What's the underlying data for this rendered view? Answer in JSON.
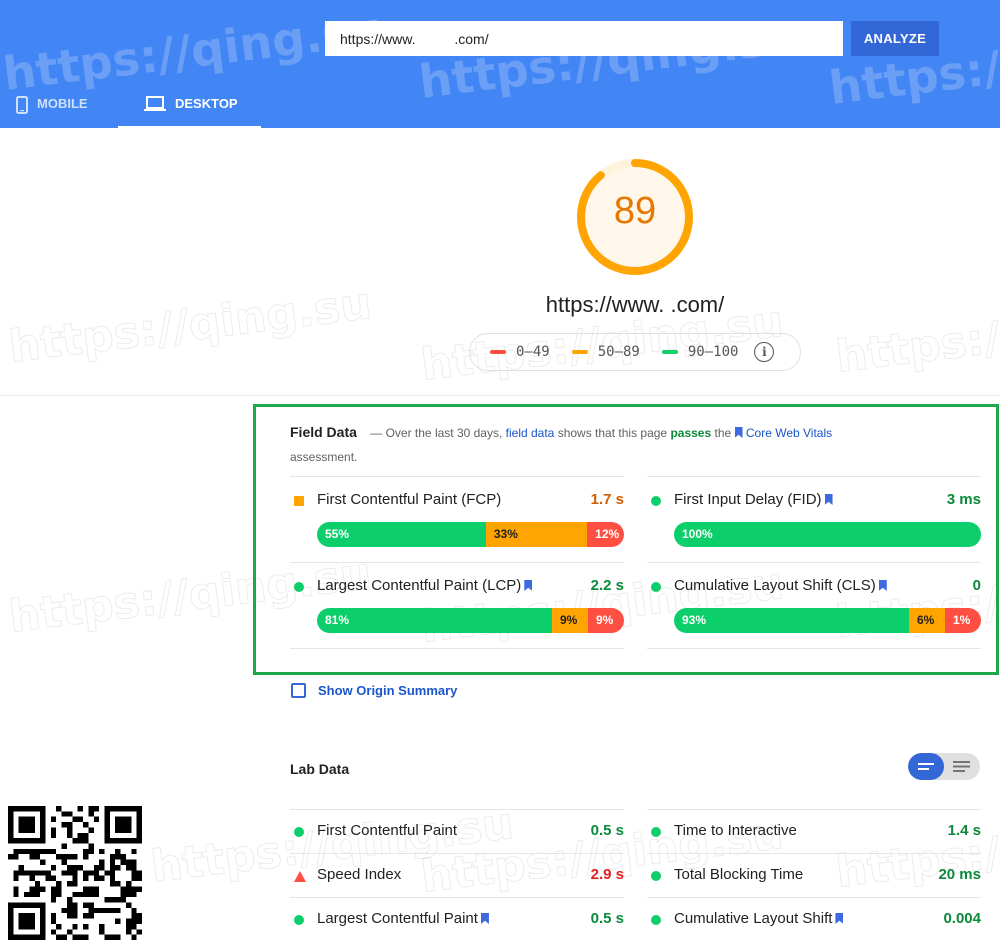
{
  "header": {
    "url_value": "https://www.          .com/",
    "analyze_label": "ANALYZE",
    "tabs": [
      {
        "label": "MOBILE",
        "icon": "mobile-phone-icon",
        "active": false
      },
      {
        "label": "DESKTOP",
        "icon": "laptop-icon",
        "active": true
      }
    ]
  },
  "watermark": "https://qing.su",
  "score": {
    "value": "89",
    "fraction": 0.89,
    "color": "#ffa400",
    "url": "https://www.          .com/"
  },
  "legend": [
    {
      "label": "0–49",
      "color": "#ff4e42"
    },
    {
      "label": "50–89",
      "color": "#ffa400"
    },
    {
      "label": "90–100",
      "color": "#0cce6b"
    }
  ],
  "legend_info_icon": "info-icon",
  "field_data": {
    "title": "Field Data",
    "desc_prefix": "— Over the last 30 days,",
    "link": "field data",
    "desc_mid": "shows that this page",
    "pass_word": "passes",
    "desc_the": "the",
    "cwv_link": "Core Web Vitals",
    "desc_suffix": "assessment.",
    "metrics": [
      {
        "label": "First Contentful Paint (FCP)",
        "value": "1.7 s",
        "status": "average",
        "bookmark": false,
        "distribution": [
          {
            "label": "55%",
            "pct": 55
          },
          {
            "label": "33%",
            "pct": 33
          },
          {
            "label": "12%",
            "pct": 12
          }
        ]
      },
      {
        "label": "First Input Delay (FID)",
        "value": "3 ms",
        "status": "good",
        "bookmark": true,
        "distribution": [
          {
            "label": "100%",
            "pct": 100
          }
        ]
      },
      {
        "label": "Largest Contentful Paint (LCP)",
        "value": "2.2 s",
        "status": "good",
        "bookmark": true,
        "distribution": [
          {
            "label": "81%",
            "pct": 81
          },
          {
            "label": "9%",
            "pct": 9
          },
          {
            "label": "9%",
            "pct": 9
          }
        ]
      },
      {
        "label": "Cumulative Layout Shift (CLS)",
        "value": "0",
        "status": "good",
        "bookmark": true,
        "distribution": [
          {
            "label": "93%",
            "pct": 93
          },
          {
            "label": "6%",
            "pct": 6
          },
          {
            "label": "1%",
            "pct": 1
          }
        ]
      }
    ]
  },
  "origin_summary_label": "Show Origin Summary",
  "lab_data": {
    "title": "Lab Data",
    "metrics": [
      {
        "label": "First Contentful Paint",
        "value": "0.5 s",
        "status": "good",
        "bookmark": false
      },
      {
        "label": "Time to Interactive",
        "value": "1.4 s",
        "status": "good",
        "bookmark": false
      },
      {
        "label": "Speed Index",
        "value": "2.9 s",
        "status": "poor",
        "bookmark": false
      },
      {
        "label": "Total Blocking Time",
        "value": "20 ms",
        "status": "good",
        "bookmark": false
      },
      {
        "label": "Largest Contentful Paint",
        "value": "0.5 s",
        "status": "good",
        "bookmark": true
      },
      {
        "label": "Cumulative Layout Shift",
        "value": "0.004",
        "status": "good",
        "bookmark": true
      }
    ]
  },
  "colors": {
    "good": "#0cce6b",
    "average": "#ffa400",
    "poor": "#ff4e42",
    "brand": "#4285f4",
    "link": "#1a55c9"
  }
}
